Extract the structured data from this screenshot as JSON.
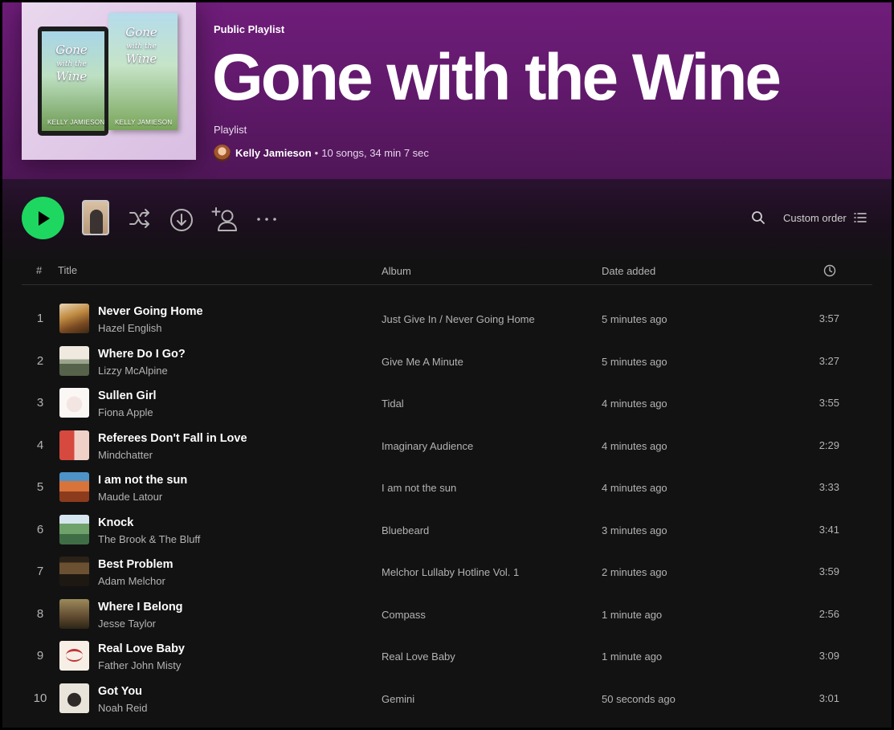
{
  "playlist": {
    "label": "Public Playlist",
    "title": "Gone with the Wine",
    "type": "Playlist",
    "owner": "Kelly Jamieson",
    "separator": "•",
    "stats": "10 songs, 34 min 7 sec",
    "cover": {
      "title_line1": "Gone",
      "title_line2": "with the",
      "title_line3": "Wine",
      "author": "KELLY JAMIESON"
    }
  },
  "actions": {
    "play_icon": "play-icon",
    "shuffle_icon": "shuffle-icon",
    "download_icon": "download-icon",
    "add_user_icon": "add-user-icon",
    "more_icon": "more-icon",
    "search_icon": "search-icon",
    "sort_label": "Custom order",
    "sort_icon": "list-icon"
  },
  "table": {
    "headers": {
      "num": "#",
      "title": "Title",
      "album": "Album",
      "date": "Date added",
      "duration_icon": "clock-icon"
    },
    "tracks": [
      {
        "num": "1",
        "title": "Never Going Home",
        "artist": "Hazel English",
        "album": "Just Give In / Never Going Home",
        "added": "5 minutes ago",
        "duration": "3:57"
      },
      {
        "num": "2",
        "title": "Where Do I Go?",
        "artist": "Lizzy McAlpine",
        "album": "Give Me A Minute",
        "added": "5 minutes ago",
        "duration": "3:27"
      },
      {
        "num": "3",
        "title": "Sullen Girl",
        "artist": "Fiona Apple",
        "album": "Tidal",
        "added": "4 minutes ago",
        "duration": "3:55"
      },
      {
        "num": "4",
        "title": "Referees Don't Fall in Love",
        "artist": "Mindchatter",
        "album": "Imaginary Audience",
        "added": "4 minutes ago",
        "duration": "2:29"
      },
      {
        "num": "5",
        "title": "I am not the sun",
        "artist": "Maude Latour",
        "album": "I am not the sun",
        "added": "4 minutes ago",
        "duration": "3:33"
      },
      {
        "num": "6",
        "title": "Knock",
        "artist": "The Brook & The Bluff",
        "album": "Bluebeard",
        "added": "3 minutes ago",
        "duration": "3:41"
      },
      {
        "num": "7",
        "title": "Best Problem",
        "artist": "Adam Melchor",
        "album": "Melchor Lullaby Hotline Vol. 1",
        "added": "2 minutes ago",
        "duration": "3:59"
      },
      {
        "num": "8",
        "title": "Where I Belong",
        "artist": "Jesse Taylor",
        "album": "Compass",
        "added": "1 minute ago",
        "duration": "2:56"
      },
      {
        "num": "9",
        "title": "Real Love Baby",
        "artist": "Father John Misty",
        "album": "Real Love Baby",
        "added": "1 minute ago",
        "duration": "3:09"
      },
      {
        "num": "10",
        "title": "Got You",
        "artist": "Noah Reid",
        "album": "Gemini",
        "added": "50 seconds ago",
        "duration": "3:01"
      }
    ]
  },
  "colors": {
    "accent": "#1ed760",
    "header_purple": "#6f1d7a",
    "background": "#121212"
  }
}
